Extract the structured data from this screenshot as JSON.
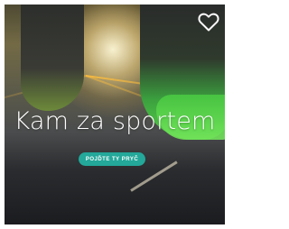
{
  "card": {
    "title": "Kam za sportem",
    "button_label": "POJĎTE TY PRYČ",
    "favorite_icon": "heart-outline-icon",
    "accent_color": "#23a89a"
  }
}
